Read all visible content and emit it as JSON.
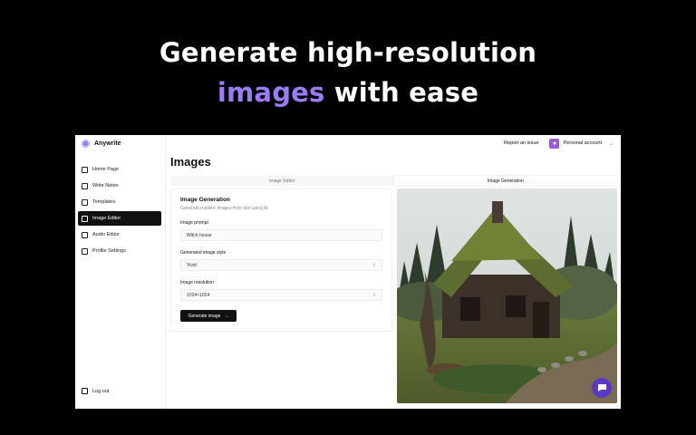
{
  "hero": {
    "line1": "Generate high-resolution",
    "accent": "images",
    "line2_rest": " with ease"
  },
  "app": {
    "brand": "Anywrite",
    "nav": [
      {
        "label": "Home Page",
        "icon": "home-icon",
        "active": false
      },
      {
        "label": "Write Notes",
        "icon": "notes-icon",
        "active": false
      },
      {
        "label": "Templates",
        "icon": "templates-icon",
        "active": false
      },
      {
        "label": "Image Editor",
        "icon": "image-icon",
        "active": true
      },
      {
        "label": "Audio Editor",
        "icon": "audio-icon",
        "active": false
      },
      {
        "label": "Profile Settings",
        "icon": "settings-icon",
        "active": false
      }
    ],
    "logout": "Log out",
    "topbar": {
      "report": "Report an issue",
      "account": "Personal account"
    },
    "page_title": "Images",
    "tabs": [
      {
        "label": "Image Editor",
        "active": false
      },
      {
        "label": "Image Generation",
        "active": true
      }
    ],
    "form": {
      "title": "Image Generation",
      "subtitle": "Generate realistic images from text using AI",
      "prompt_label": "Image prompt",
      "prompt_value": "Witch house",
      "style_label": "Generated image style",
      "style_value": "Vivid",
      "resolution_label": "Image resolution",
      "resolution_value": "1024×1024",
      "button": "Generate image"
    },
    "colors": {
      "accent": "#9b7bf7",
      "chat": "#5b39c6",
      "avatar": "#9a58df"
    }
  }
}
